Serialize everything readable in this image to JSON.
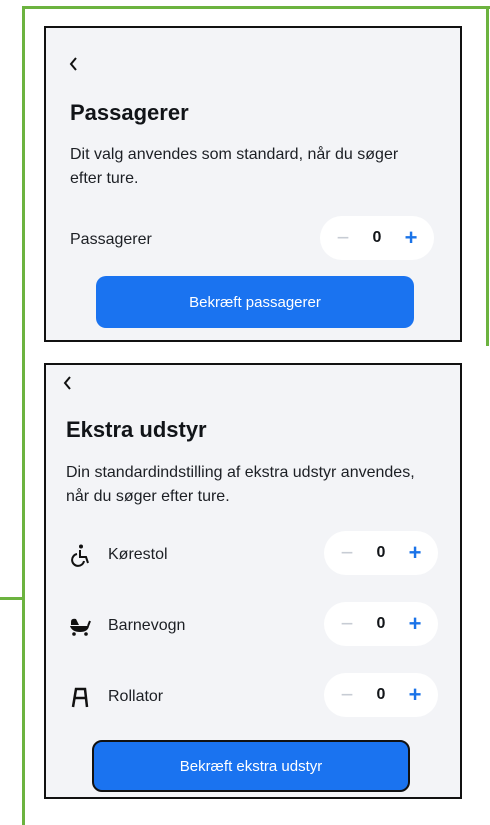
{
  "passengers_screen": {
    "title": "Passagerer",
    "description": "Dit valg anvendes som standard, når du søger efter ture.",
    "row_label": "Passagerer",
    "count": "0",
    "minus": "−",
    "plus": "+",
    "confirm_label": "Bekræft passagerer"
  },
  "equipment_screen": {
    "title": "Ekstra udstyr",
    "description": "Din standardindstilling af ekstra udstyr anvendes, når du søger efter ture.",
    "items": [
      {
        "label": "Kørestol",
        "icon": "wheelchair-icon",
        "count": "0"
      },
      {
        "label": "Barnevogn",
        "icon": "stroller-icon",
        "count": "0"
      },
      {
        "label": "Rollator",
        "icon": "rollator-icon",
        "count": "0"
      }
    ],
    "minus": "−",
    "plus": "+",
    "confirm_label": "Bekræft ekstra udstyr"
  },
  "colors": {
    "accent": "#1a73f0",
    "panel_bg": "#f3f4f7",
    "frame_green": "#6cb33f"
  }
}
